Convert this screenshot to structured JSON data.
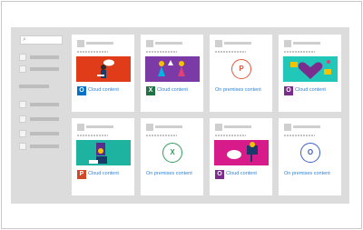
{
  "search": {
    "icon": "search-icon",
    "glyph": "⌕"
  },
  "nav": {
    "items": 4
  },
  "cards": [
    {
      "label": "Cloud content",
      "icon": "O",
      "icon_name": "outlook-icon",
      "icon_color": "#0072c6",
      "thumb_color": "#e03c1a"
    },
    {
      "label": "Cloud content",
      "icon": "X",
      "icon_name": "excel-icon",
      "icon_color": "#207245",
      "thumb_color": "#7b3aa6"
    },
    {
      "label": "On premises content",
      "icon": "P",
      "icon_name": "powerpoint-icon",
      "icon_color": "#e8543a",
      "thumb_color": "#ffffff"
    },
    {
      "label": "Cloud content",
      "icon": "O",
      "icon_name": "onenote-icon",
      "icon_color": "#7a2d8c",
      "thumb_color": "#21c7b8"
    },
    {
      "label": "Cloud content",
      "icon": "P",
      "icon_name": "powerpoint-icon",
      "icon_color": "#d24726",
      "thumb_color": "#1db3a0"
    },
    {
      "label": "On premises content",
      "icon": "X",
      "icon_name": "excel-icon",
      "icon_color": "#2f9e5a",
      "thumb_color": "#ffffff"
    },
    {
      "label": "Cloud content",
      "icon": "O",
      "icon_name": "onenote-icon",
      "icon_color": "#7a2d8c",
      "thumb_color": "#d81b8a"
    },
    {
      "label": "On premises content",
      "icon": "O",
      "icon_name": "outlook-icon",
      "icon_color": "#3b5fbf",
      "thumb_color": "#ffffff"
    }
  ]
}
